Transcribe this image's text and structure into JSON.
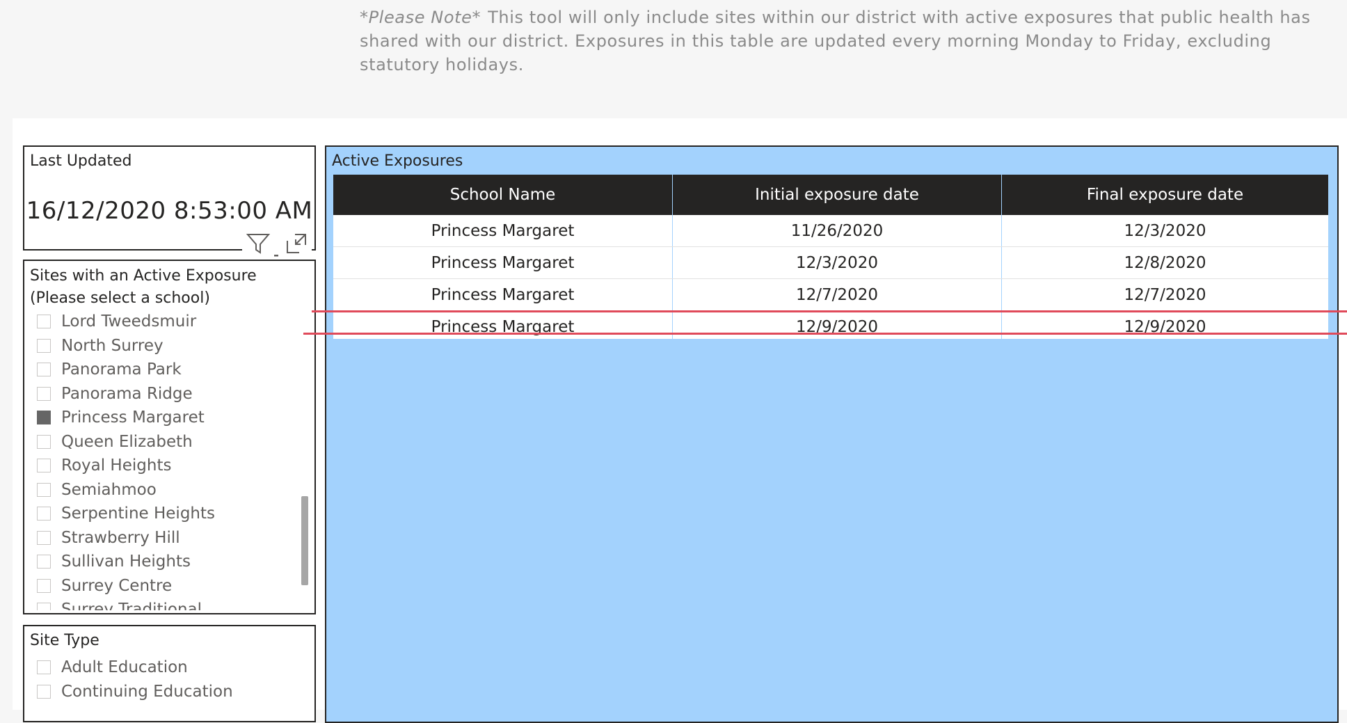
{
  "note": {
    "emphasis": "*Please Note*",
    "text": "This tool will only include sites within our district with active exposures that public health has shared with our district. Exposures in this table are updated every morning Monday to Friday, excluding statutory holidays."
  },
  "last_updated": {
    "title": "Last Updated",
    "value": "16/12/2020 8:53:00 AM"
  },
  "visual_header": {
    "filter_icon": "filter-icon",
    "focus_icon": "focus-mode-icon"
  },
  "sites_slicer": {
    "title_line1": "Sites with an Active Exposure",
    "title_line2": "(Please select a school)",
    "items": [
      {
        "label": "Lord Tweedsmuir",
        "checked": false
      },
      {
        "label": "North Surrey",
        "checked": false
      },
      {
        "label": "Panorama Park",
        "checked": false
      },
      {
        "label": "Panorama Ridge",
        "checked": false
      },
      {
        "label": "Princess Margaret",
        "checked": true
      },
      {
        "label": "Queen Elizabeth",
        "checked": false
      },
      {
        "label": "Royal Heights",
        "checked": false
      },
      {
        "label": "Semiahmoo",
        "checked": false
      },
      {
        "label": "Serpentine Heights",
        "checked": false
      },
      {
        "label": "Strawberry Hill",
        "checked": false
      },
      {
        "label": "Sullivan Heights",
        "checked": false
      },
      {
        "label": "Surrey Centre",
        "checked": false
      },
      {
        "label": "Surrey Traditional",
        "checked": false
      }
    ]
  },
  "site_type_slicer": {
    "title": "Site Type",
    "items": [
      {
        "label": "Adult Education",
        "checked": false
      },
      {
        "label": "Continuing Education",
        "checked": false
      }
    ]
  },
  "exposures": {
    "title": "Active Exposures",
    "columns": [
      "School Name",
      "Initial exposure date",
      "Final exposure date"
    ],
    "rows": [
      [
        "Princess Margaret",
        "11/26/2020",
        "12/3/2020"
      ],
      [
        "Princess Margaret",
        "12/3/2020",
        "12/8/2020"
      ],
      [
        "Princess Margaret",
        "12/7/2020",
        "12/7/2020"
      ],
      [
        "Princess Margaret",
        "12/9/2020",
        "12/9/2020"
      ]
    ]
  },
  "colors": {
    "table_bg": "#a3d2fd",
    "header_bg": "#252423",
    "annotation_red": "#e04a5a",
    "checked_box": "#666666"
  }
}
